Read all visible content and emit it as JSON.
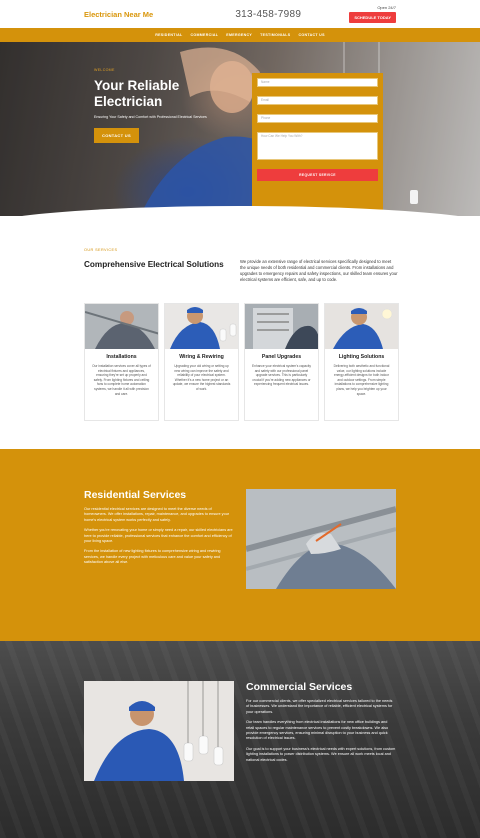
{
  "header": {
    "brand": "Electrician Near Me",
    "phone": "313-458-7989",
    "open": "Open 24/7",
    "schedule_button": "SCHEDULE TODAY"
  },
  "nav": {
    "items": [
      "RESIDENTIAL",
      "COMMERCIAL",
      "EMERGENCY",
      "TESTIMONIALS",
      "CONTACT US"
    ]
  },
  "hero": {
    "welcome": "WELCOME",
    "title_line1": "Your Reliable",
    "title_line2": "Electrician",
    "subtitle": "Ensuring Your Safety and Comfort with Professional Electrical Services",
    "contact_button": "CONTACT US"
  },
  "form": {
    "name_placeholder": "Name",
    "email_placeholder": "Email",
    "phone_placeholder": "Phone",
    "message_placeholder": "How Can We Help You With?",
    "submit": "REQUEST SERVICE"
  },
  "services": {
    "label": "OUR SERVICES",
    "title": "Comprehensive Electrical Solutions",
    "description": "We provide an extensive range of electrical services specifically designed to meet the unique needs of both residential and commercial clients. From installations and upgrades to emergency repairs and safety inspections, our skilled team ensures your electrical systems are efficient, safe, and up to code.",
    "cards": [
      {
        "name": "Installations",
        "text": "Our installation services cover all types of electrical fixtures and appliances, ensuring they're set up properly and safely. From lighting fixtures and ceiling fans to complete home automation systems, we handle it all with precision and care."
      },
      {
        "name": "Wiring & Rewiring",
        "text": "Upgrading your old wiring or setting up new wiring can improve the safety and reliability of your electrical system. Whether it's a new home project or an update, we ensure the highest standards of work."
      },
      {
        "name": "Panel Upgrades",
        "text": "Enhance your electrical system's capacity and safety with our professional panel upgrade services. This is particularly crucial if you're adding new appliances or experiencing frequent electrical issues."
      },
      {
        "name": "Lighting Solutions",
        "text": "Delivering both aesthetic and functional value, our lighting solutions include energy-efficient designs for both indoor and outdoor settings. From simple installations to comprehensive lighting plans, we help you brighten up your space."
      }
    ]
  },
  "residential": {
    "title": "Residential Services",
    "paragraphs": [
      "Our residential electrical services are designed to meet the diverse needs of homeowners. We offer installations, repair, maintenance, and upgrades to ensure your home's electrical system works perfectly and safely.",
      "Whether you're renovating your home or simply need a repair, our skilled electricians are here to provide reliable, professional services that enhance the comfort and efficiency of your living space.",
      "From the installation of new lighting fixtures to comprehensive wiring and rewiring services, we handle every project with meticulous care and value your safety and satisfaction above all else."
    ]
  },
  "commercial": {
    "title": "Commercial Services",
    "paragraphs": [
      "For our commercial clients, we offer specialized electrical services tailored to the needs of businesses. We understand the importance of reliable, efficient electrical systems for your operations.",
      "Our team handles everything from electrical installations for new office buildings and retail spaces to regular maintenance services to prevent costly breakdowns. We also provide emergency services, ensuring minimal disruption to your business and quick resolution of electrical issues.",
      "Our goal is to support your business's electrical needs with expert solutions, from custom lighting installations to power distribution systems. We ensure all work meets local and national electrical codes."
    ]
  },
  "colors": {
    "accent": "#d4920b",
    "cta": "#ee3d3d",
    "dark": "#3b3b3b"
  }
}
